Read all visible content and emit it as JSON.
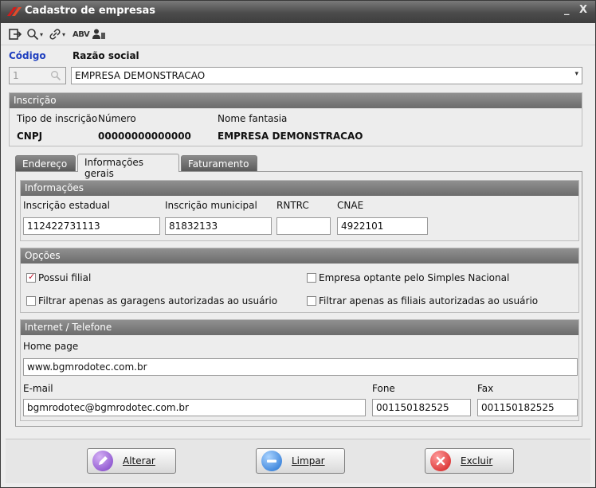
{
  "window": {
    "title": "Cadastro de empresas",
    "minimize": "_",
    "close": "X"
  },
  "toolbar": {
    "spell_label": "ABV",
    "dropdown_glyph": "▾"
  },
  "company": {
    "codigo_label": "Código",
    "razao_label": "Razão social",
    "codigo_value": "1",
    "razao_value": "EMPRESA DEMONSTRACAO"
  },
  "inscricao": {
    "header": "Inscrição",
    "tipo_label": "Tipo de inscrição",
    "numero_label": "Número",
    "fantasia_label": "Nome fantasia",
    "tipo_value": "CNPJ",
    "numero_value": "00000000000000",
    "fantasia_value": "EMPRESA DEMONSTRACAO"
  },
  "tabs": [
    {
      "label": "Endereço"
    },
    {
      "label": "Informações gerais"
    },
    {
      "label": "Faturamento"
    }
  ],
  "informacoes": {
    "header": "Informações",
    "ie_label": "Inscrição estadual",
    "im_label": "Inscrição municipal",
    "rntrc_label": "RNTRC",
    "cnae_label": "CNAE",
    "ie_value": "112422731113",
    "im_value": "81832133",
    "rntrc_value": "",
    "cnae_value": "4922101"
  },
  "opcoes": {
    "header": "Opções",
    "possui_filial": "Possui filial",
    "filtrar_garagens": "Filtrar apenas as garagens autorizadas ao usuário",
    "simples": "Empresa optante pelo Simples Nacional",
    "filtrar_filiais": "Filtrar apenas as filiais autorizadas ao usuário"
  },
  "internet": {
    "header": "Internet / Telefone",
    "homepage_label": "Home page",
    "homepage_value": "www.bgmrodotec.com.br",
    "email_label": "E-mail",
    "email_value": "bgmrodotec@bgmrodotec.com.br",
    "fone_label": "Fone",
    "fone_value": "001150182525",
    "fax_label": "Fax",
    "fax_value": "001150182525"
  },
  "buttons": {
    "alterar": "Alterar",
    "limpar": "Limpar",
    "excluir": "Excluir"
  },
  "colors": {
    "title_bar": "#4b4b4b",
    "group_header": "#7c7c7c",
    "accent_blue": "#1f3fbf",
    "check_red": "#c0102a"
  }
}
